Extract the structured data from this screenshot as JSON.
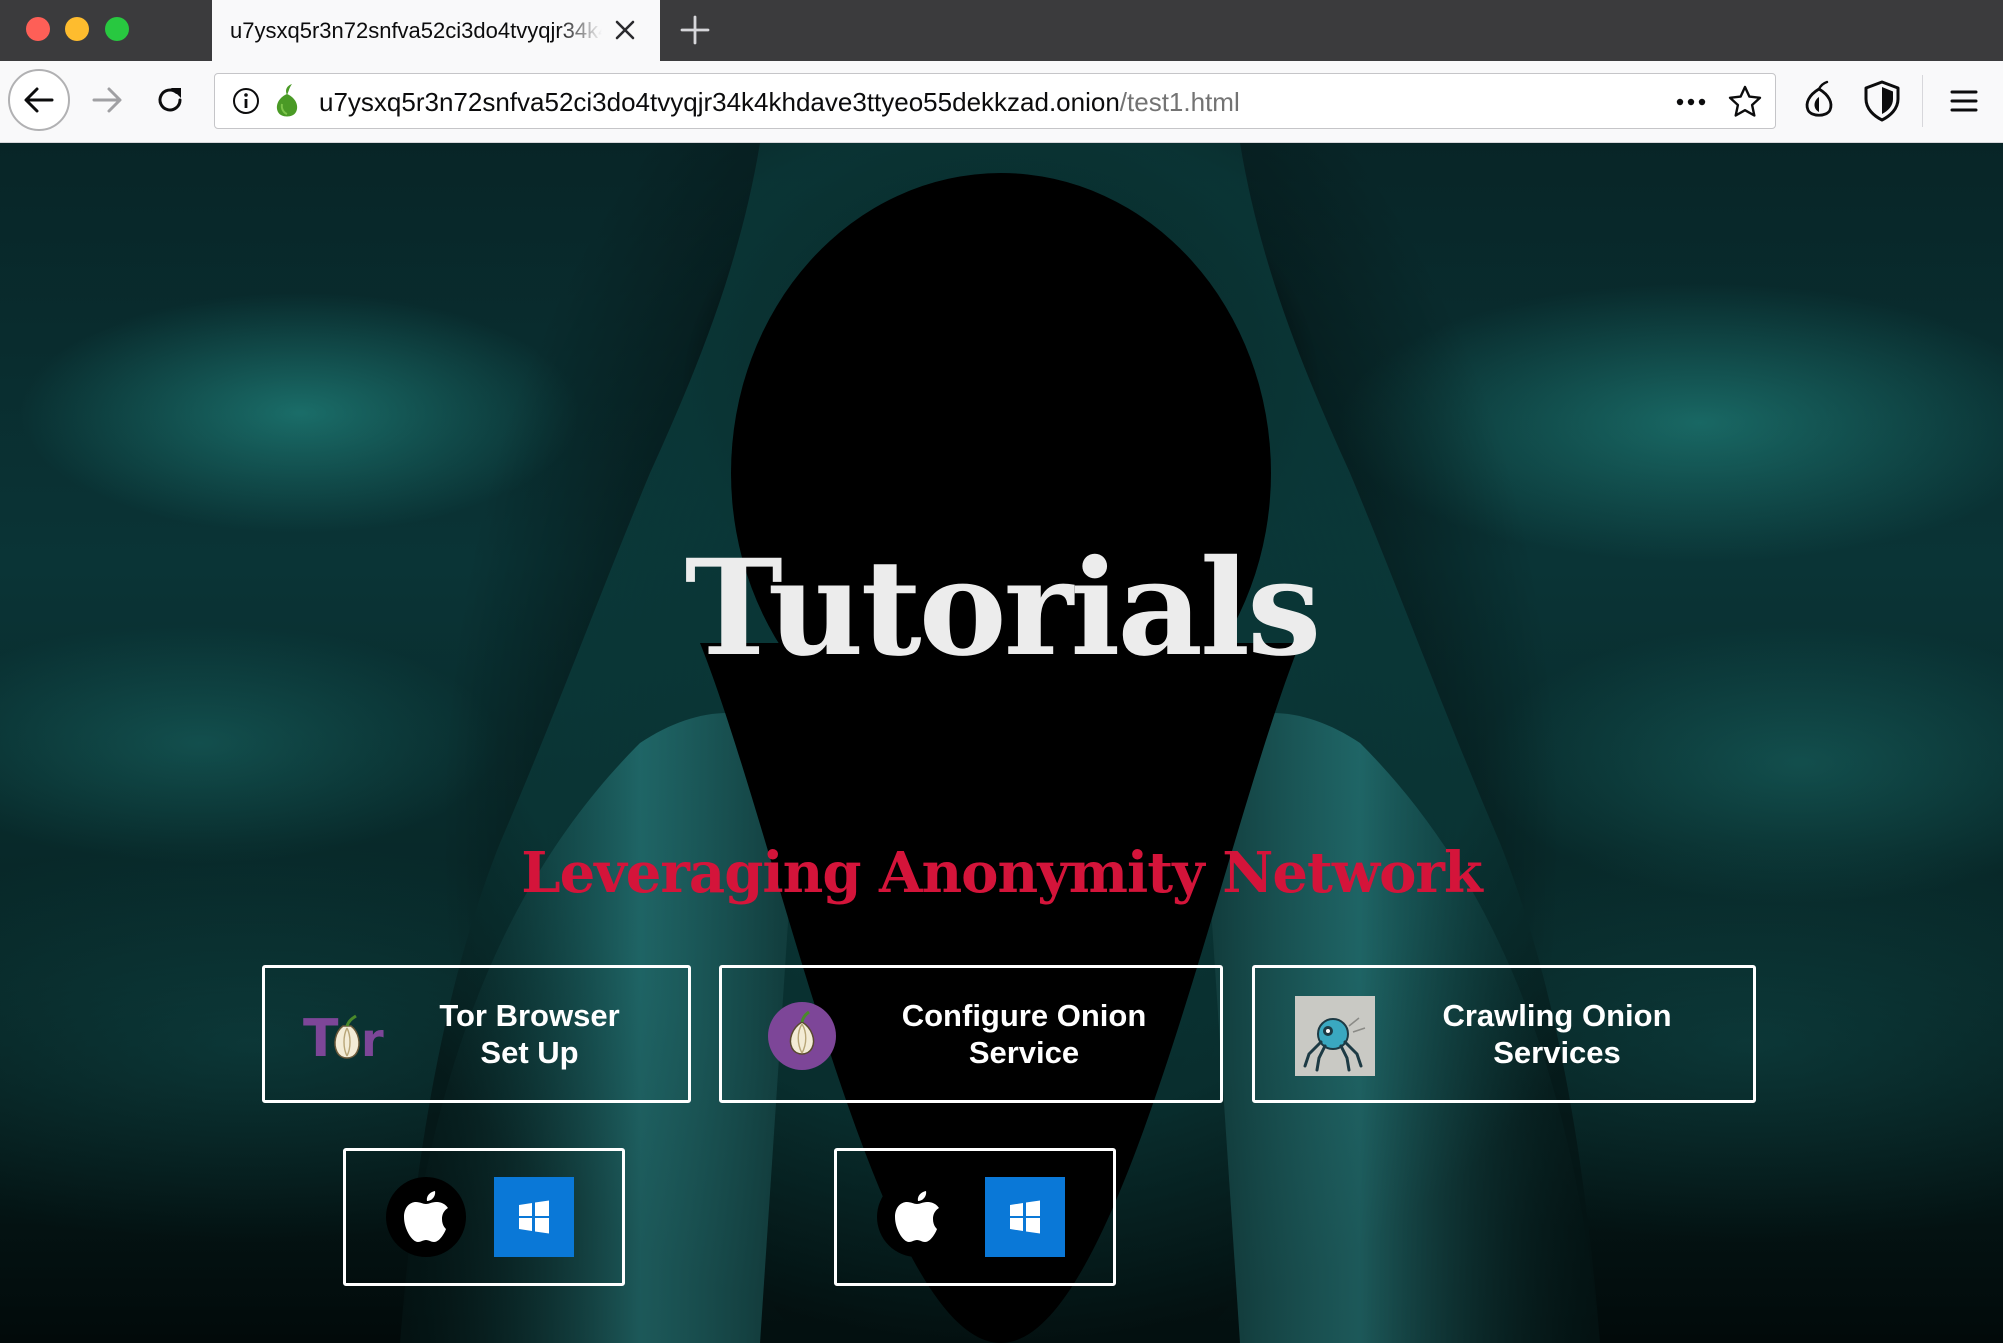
{
  "browser": {
    "tab": {
      "title": "u7ysxq5r3n72snfva52ci3do4tvyqjr34k4khdave3ttyeo55dekkzad.onion/test1.html"
    },
    "url": {
      "host": "u7ysxq5r3n72snfva52ci3do4tvyqjr34k4khdave3ttyeo55dekkzad.onion",
      "path": "/test1.html"
    }
  },
  "page": {
    "title": "Tutorials",
    "subtitle": "Leveraging Anonymity Network",
    "cards": [
      {
        "line1": "Tor Browser",
        "line2": "Set Up",
        "icon": "tor-logo-icon"
      },
      {
        "line1": "Configure Onion",
        "line2": "Service",
        "icon": "onion-icon"
      },
      {
        "line1": "Crawling Onion",
        "line2": "Services",
        "icon": "spider-robot-icon"
      }
    ],
    "downloads": [
      {
        "icons": [
          "apple-icon",
          "windows-icon"
        ]
      },
      {
        "icons": [
          "apple-icon",
          "windows-icon"
        ]
      }
    ]
  },
  "colors": {
    "subtitle": "#d4143a",
    "tor_purple": "#7d4698",
    "windows_blue": "#0a78d7"
  }
}
